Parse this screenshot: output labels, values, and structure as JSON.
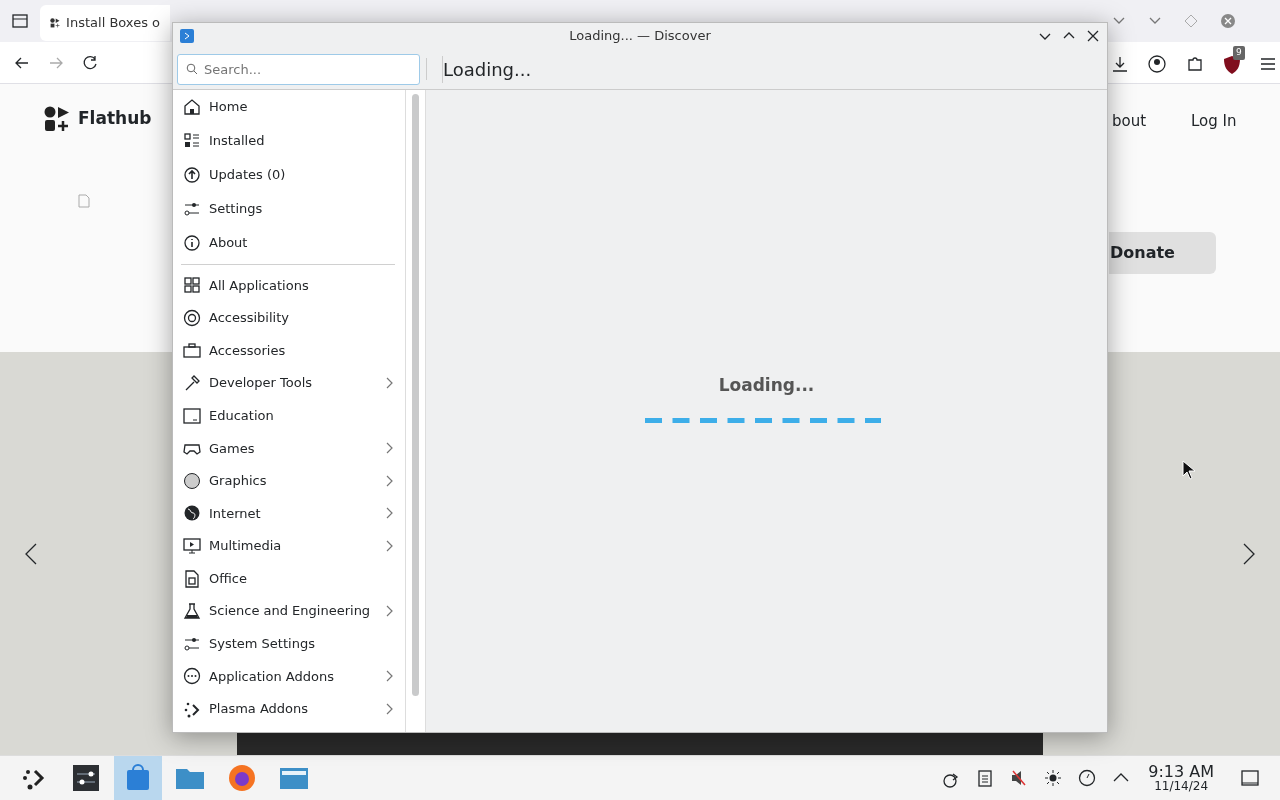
{
  "browser": {
    "tab": {
      "title": "Install Boxes o"
    },
    "extension_badge": "9"
  },
  "page": {
    "logo": "Flathub",
    "nav": [
      "bout",
      "Log In"
    ],
    "donate": "Donate"
  },
  "window": {
    "title": "Loading... — Discover",
    "search": {
      "placeholder": "Search..."
    },
    "heading": "Loading...",
    "loading_text": "Loading...",
    "nav_items": [
      {
        "label": "Home"
      },
      {
        "label": "Installed"
      },
      {
        "label": "Updates (0)"
      },
      {
        "label": "Settings"
      },
      {
        "label": "About"
      }
    ],
    "categories": [
      {
        "label": "All Applications",
        "expandable": false
      },
      {
        "label": "Accessibility",
        "expandable": false
      },
      {
        "label": "Accessories",
        "expandable": false
      },
      {
        "label": "Developer Tools",
        "expandable": true
      },
      {
        "label": "Education",
        "expandable": false
      },
      {
        "label": "Games",
        "expandable": true
      },
      {
        "label": "Graphics",
        "expandable": true
      },
      {
        "label": "Internet",
        "expandable": true
      },
      {
        "label": "Multimedia",
        "expandable": true
      },
      {
        "label": "Office",
        "expandable": false
      },
      {
        "label": "Science and Engineering",
        "expandable": true
      },
      {
        "label": "System Settings",
        "expandable": false
      },
      {
        "label": "Application Addons",
        "expandable": true
      },
      {
        "label": "Plasma Addons",
        "expandable": true
      }
    ]
  },
  "taskbar": {
    "time": "9:13 AM",
    "date": "11/14/24"
  }
}
